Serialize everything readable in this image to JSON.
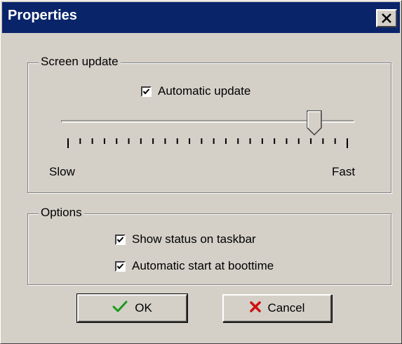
{
  "window": {
    "title": "Properties",
    "close_symbol": "✕"
  },
  "screen_update": {
    "legend": "Screen update",
    "automatic_update_label": "Automatic update",
    "automatic_update_checked": true,
    "slider_min_label": "Slow",
    "slider_max_label": "Fast",
    "slider_value": 0.88,
    "tick_count": 24
  },
  "options": {
    "legend": "Options",
    "show_status_label": "Show status on taskbar",
    "show_status_checked": true,
    "auto_start_label": "Automatic start at boottime",
    "auto_start_checked": true
  },
  "buttons": {
    "ok_label": "OK",
    "ok_icon": "checkmark-icon",
    "cancel_label": "Cancel",
    "cancel_icon": "red-x-icon"
  },
  "colors": {
    "titlebar": "#0a246a",
    "face": "#d4d0c8",
    "ok_icon": "#1a9a1a",
    "cancel_icon": "#d01010"
  }
}
